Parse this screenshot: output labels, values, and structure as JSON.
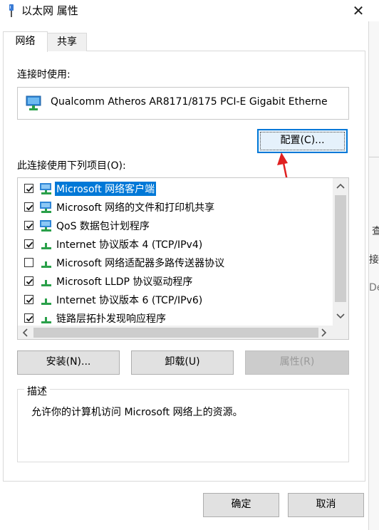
{
  "window": {
    "title": "以太网 属性",
    "close_glyph": "✕"
  },
  "tabs": [
    {
      "label": "网络",
      "active": true
    },
    {
      "label": "共享",
      "active": false
    }
  ],
  "connect_label": "连接时使用:",
  "adapter": {
    "name": "Qualcomm Atheros AR8171/8175 PCI-E Gigabit Etherne",
    "icon": "network-adapter-icon"
  },
  "configure_button": "配置(C)...",
  "items_label": "此连接使用下列项目(O):",
  "items": [
    {
      "label": "Microsoft 网络客户端",
      "checked": true,
      "icon": "network-client-icon",
      "selected": true
    },
    {
      "label": "Microsoft 网络的文件和打印机共享",
      "checked": true,
      "icon": "network-client-icon",
      "selected": false
    },
    {
      "label": "QoS 数据包计划程序",
      "checked": true,
      "icon": "network-client-icon",
      "selected": false
    },
    {
      "label": "Internet 协议版本 4 (TCP/IPv4)",
      "checked": true,
      "icon": "protocol-icon",
      "selected": false
    },
    {
      "label": "Microsoft 网络适配器多路传送器协议",
      "checked": false,
      "icon": "protocol-icon",
      "selected": false
    },
    {
      "label": "Microsoft LLDP 协议驱动程序",
      "checked": true,
      "icon": "protocol-icon",
      "selected": false
    },
    {
      "label": "Internet 协议版本 6 (TCP/IPv6)",
      "checked": true,
      "icon": "protocol-icon",
      "selected": false
    },
    {
      "label": "链路层拓扑发现响应程序",
      "checked": true,
      "icon": "protocol-icon",
      "selected": false
    }
  ],
  "buttons": {
    "install": "安装(N)...",
    "uninstall": "卸载(U)",
    "properties": "属性(R)",
    "ok": "确定",
    "cancel": "取消"
  },
  "description": {
    "legend": "描述",
    "text": "允许你的计算机访问 Microsoft 网络上的资源。"
  },
  "background_window": {
    "fragment_1": "查",
    "fragment_2": "接",
    "fragment_3": "De"
  },
  "colors": {
    "accent": "#0078d7",
    "annotation_arrow": "#e02020"
  }
}
